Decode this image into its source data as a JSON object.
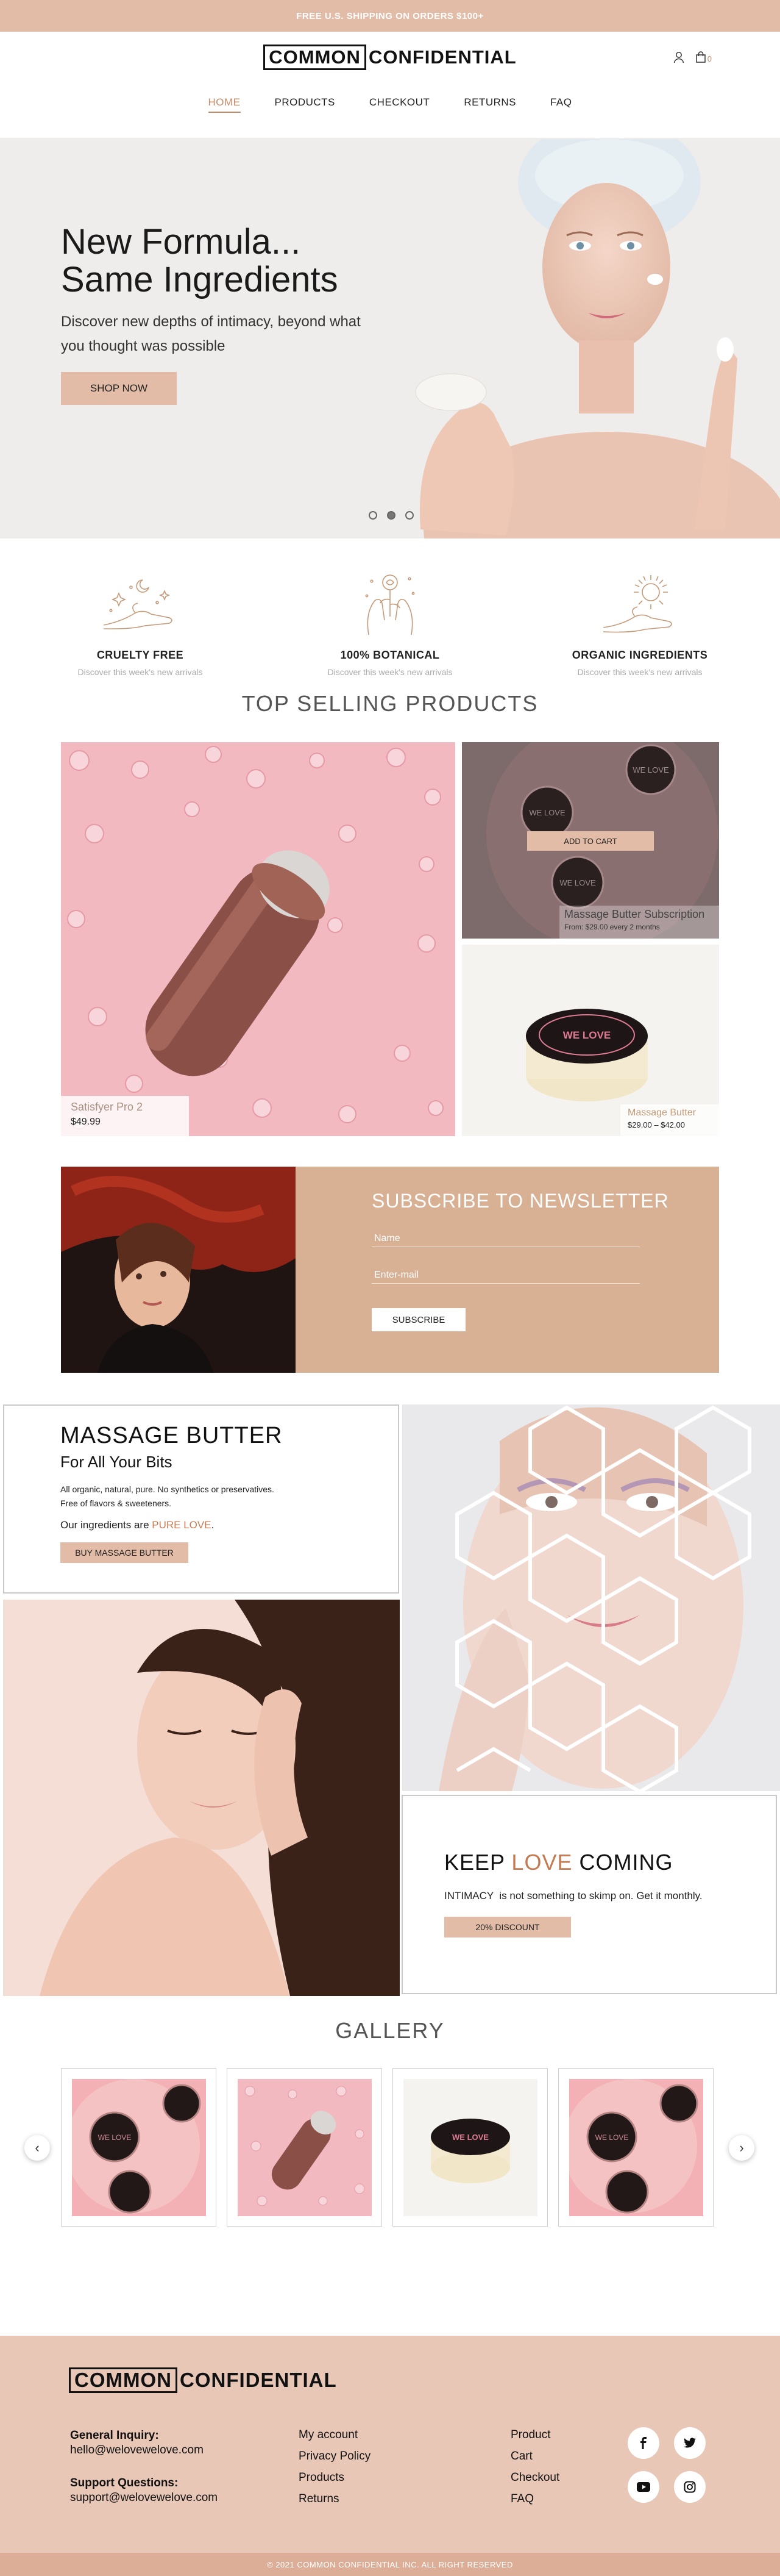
{
  "topbar": {
    "text": "FREE U.S. SHIPPING ON ORDERS $100+"
  },
  "header": {
    "logo_boxed": "COMMON",
    "logo_rest": "CONFIDENTIAL",
    "cart_count": "0"
  },
  "nav": {
    "items": [
      "HOME",
      "PRODUCTS",
      "CHECKOUT",
      "RETURNS",
      "FAQ"
    ]
  },
  "hero": {
    "title_line1": "New Formula...",
    "title_line2": "Same Ingredients",
    "subtitle": "Discover new depths of intimacy, beyond what you thought was possible",
    "button": "SHOP NOW",
    "slides": 3,
    "active_slide": 2
  },
  "features": [
    {
      "title": "CRUELTY FREE",
      "subtitle": "Discover this week's new arrivals",
      "icon": "hand-moon-stars-icon"
    },
    {
      "title": "100% BOTANICAL",
      "subtitle": "Discover this week's new arrivals",
      "icon": "hands-rose-icon"
    },
    {
      "title": "ORGANIC INGREDIENTS",
      "subtitle": "Discover this week's new arrivals",
      "icon": "hand-sun-icon"
    }
  ],
  "top_selling": {
    "title": "TOP SELLING PRODUCTS",
    "products": [
      {
        "name": "Satisfyer Pro 2",
        "price": "$49.99"
      },
      {
        "name": "Massage Butter Subscription",
        "price": "From: $29.00 every 2 months",
        "button": "ADD TO CART",
        "jar_text": "WE LOVE"
      },
      {
        "name": "Massage Butter",
        "price": "$29.00 – $42.00",
        "jar_text": "WE LOVE"
      }
    ]
  },
  "newsletter": {
    "title": "SUBSCRIBE TO NEWSLETTER",
    "name_placeholder": "Name",
    "email_placeholder": "Enter-mail",
    "button": "SUBSCRIBE"
  },
  "massage_butter": {
    "title": "MASSAGE BUTTER",
    "subtitle": "For All Your Bits",
    "line1": "All organic, natural, pure. No synthetics or preservatives.",
    "line2": "Free of flavors & sweeteners.",
    "ingredients_prefix": "Our ingredients are",
    "ingredients_accent": "PURE LOVE",
    "ingredients_suffix": ".",
    "button": "BUY MASSAGE BUTTER"
  },
  "keep_love": {
    "title_prefix": "KEEP",
    "title_accent": "LOVE",
    "title_suffix": "COMING",
    "text": "INTIMACY  is not something to skimp on. Get it monthly.",
    "button": "20% DISCOUNT"
  },
  "gallery": {
    "title": "GALLERY",
    "prev": "‹",
    "next": "›",
    "jar_text": "WE LOVE"
  },
  "footer": {
    "logo_boxed": "COMMON",
    "logo_rest": "CONFIDENTIAL",
    "general_label": "General Inquiry:",
    "general_email": "hello@welovewelove.com",
    "support_label": "Support Questions:",
    "support_email": "support@welovewelove.com",
    "account_links": [
      "My account",
      "Privacy Policy",
      "Products",
      "Returns"
    ],
    "shop_links": [
      "Product",
      "Cart",
      "Checkout",
      "FAQ"
    ],
    "social": [
      "facebook-icon",
      "twitter-icon",
      "youtube-icon",
      "instagram-icon"
    ],
    "copyright": "© 2021 COMMON CONFIDENTIAL INC. ALL RIGHT RESERVED"
  },
  "colors": {
    "peach": "#e2bca7",
    "newsletter_bg": "#d8b094",
    "accent": "#c47b54",
    "footer_bg": "#e8c7b7"
  }
}
